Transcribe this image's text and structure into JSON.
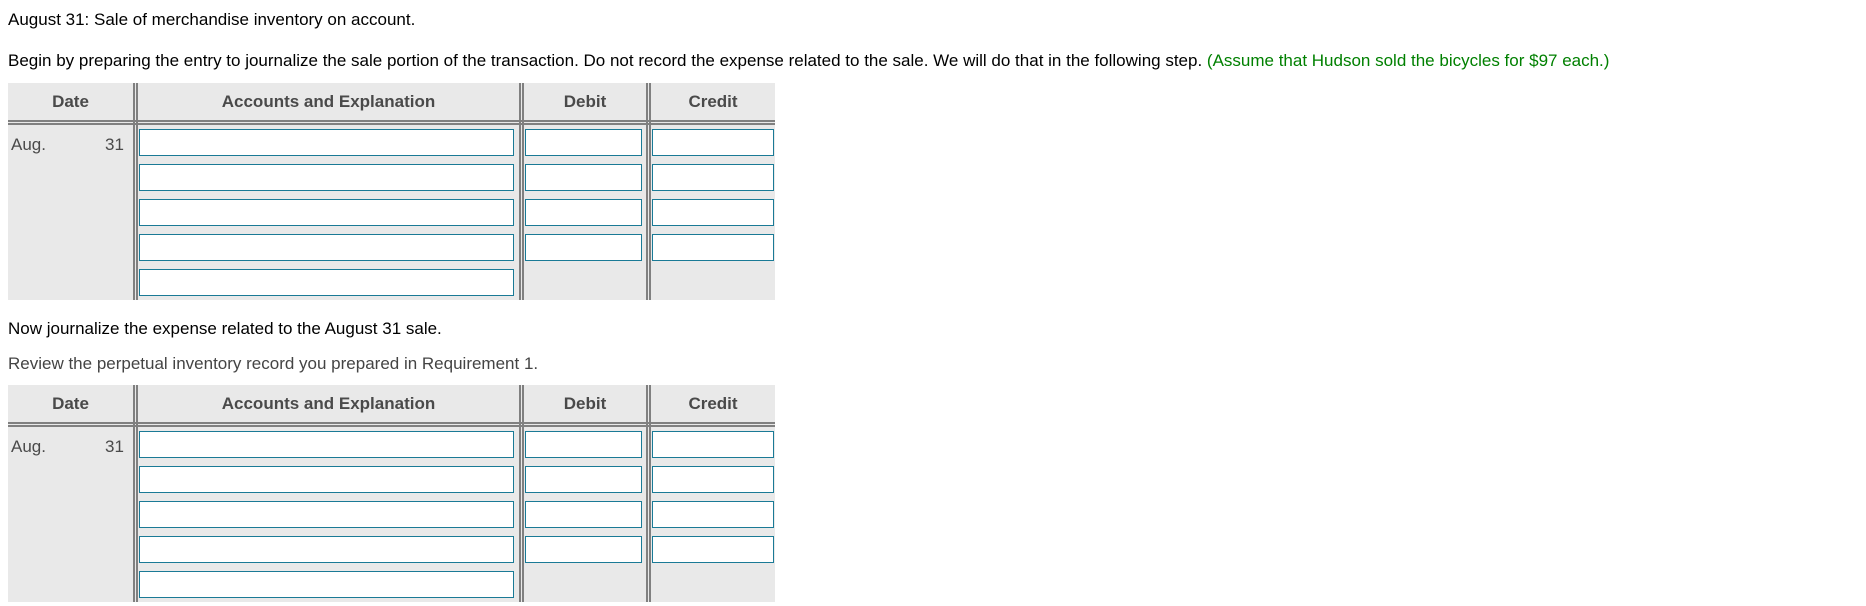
{
  "intro": {
    "line1": "August 31: Sale of merchandise inventory on account.",
    "line2_main": "Begin by preparing the entry to journalize the sale portion of the transaction. Do not record the expense related to the sale. We will do that in the following step. ",
    "line2_hint": "(Assume that Hudson sold the bicycles for $97 each.)",
    "hint_color": "#008000"
  },
  "middle": {
    "line1": "Now journalize the expense related to the August 31 sale.",
    "line2": "Review the perpetual inventory record you prepared in Requirement 1."
  },
  "journals": [
    {
      "headers": {
        "date": "Date",
        "accounts": "Accounts and Explanation",
        "debit": "Debit",
        "credit": "Credit"
      },
      "date_month": "Aug.",
      "date_day": "31",
      "rows": [
        {
          "account": "",
          "debit": "",
          "credit": ""
        },
        {
          "account": "",
          "debit": "",
          "credit": ""
        },
        {
          "account": "",
          "debit": "",
          "credit": ""
        },
        {
          "account": "",
          "debit": "",
          "credit": ""
        },
        {
          "account": ""
        }
      ]
    },
    {
      "headers": {
        "date": "Date",
        "accounts": "Accounts and Explanation",
        "debit": "Debit",
        "credit": "Credit"
      },
      "date_month": "Aug.",
      "date_day": "31",
      "rows": [
        {
          "account": "",
          "debit": "",
          "credit": ""
        },
        {
          "account": "",
          "debit": "",
          "credit": ""
        },
        {
          "account": "",
          "debit": "",
          "credit": ""
        },
        {
          "account": "",
          "debit": "",
          "credit": ""
        },
        {
          "account": ""
        }
      ]
    }
  ]
}
